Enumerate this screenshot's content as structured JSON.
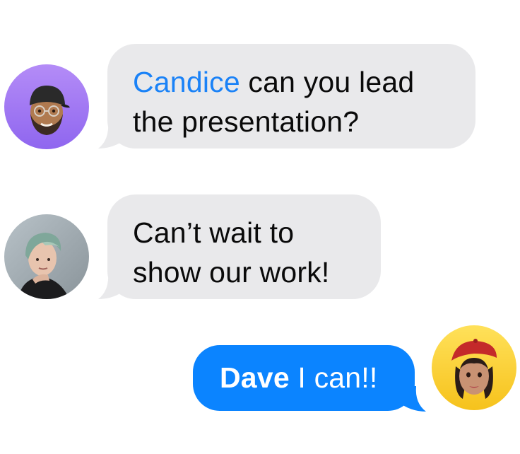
{
  "colors": {
    "incoming_bubble": "#e9e9eb",
    "outgoing_bubble": "#0b84ff",
    "mention_incoming": "#1a82f7",
    "text_dark": "#0a0a0a",
    "text_light": "#ffffff"
  },
  "messages": [
    {
      "direction": "incoming",
      "avatar": "memoji-man-cap-avatar",
      "mention": "Candice",
      "line1_rest": "can you lead",
      "line2": "the presentation?"
    },
    {
      "direction": "incoming",
      "avatar": "photo-woman-green-hair-avatar",
      "line1": "Can’t wait to",
      "line2": "show our work!"
    },
    {
      "direction": "outgoing",
      "avatar": "memoji-woman-beret-avatar",
      "mention": "Dave",
      "rest": "I can!!"
    }
  ]
}
